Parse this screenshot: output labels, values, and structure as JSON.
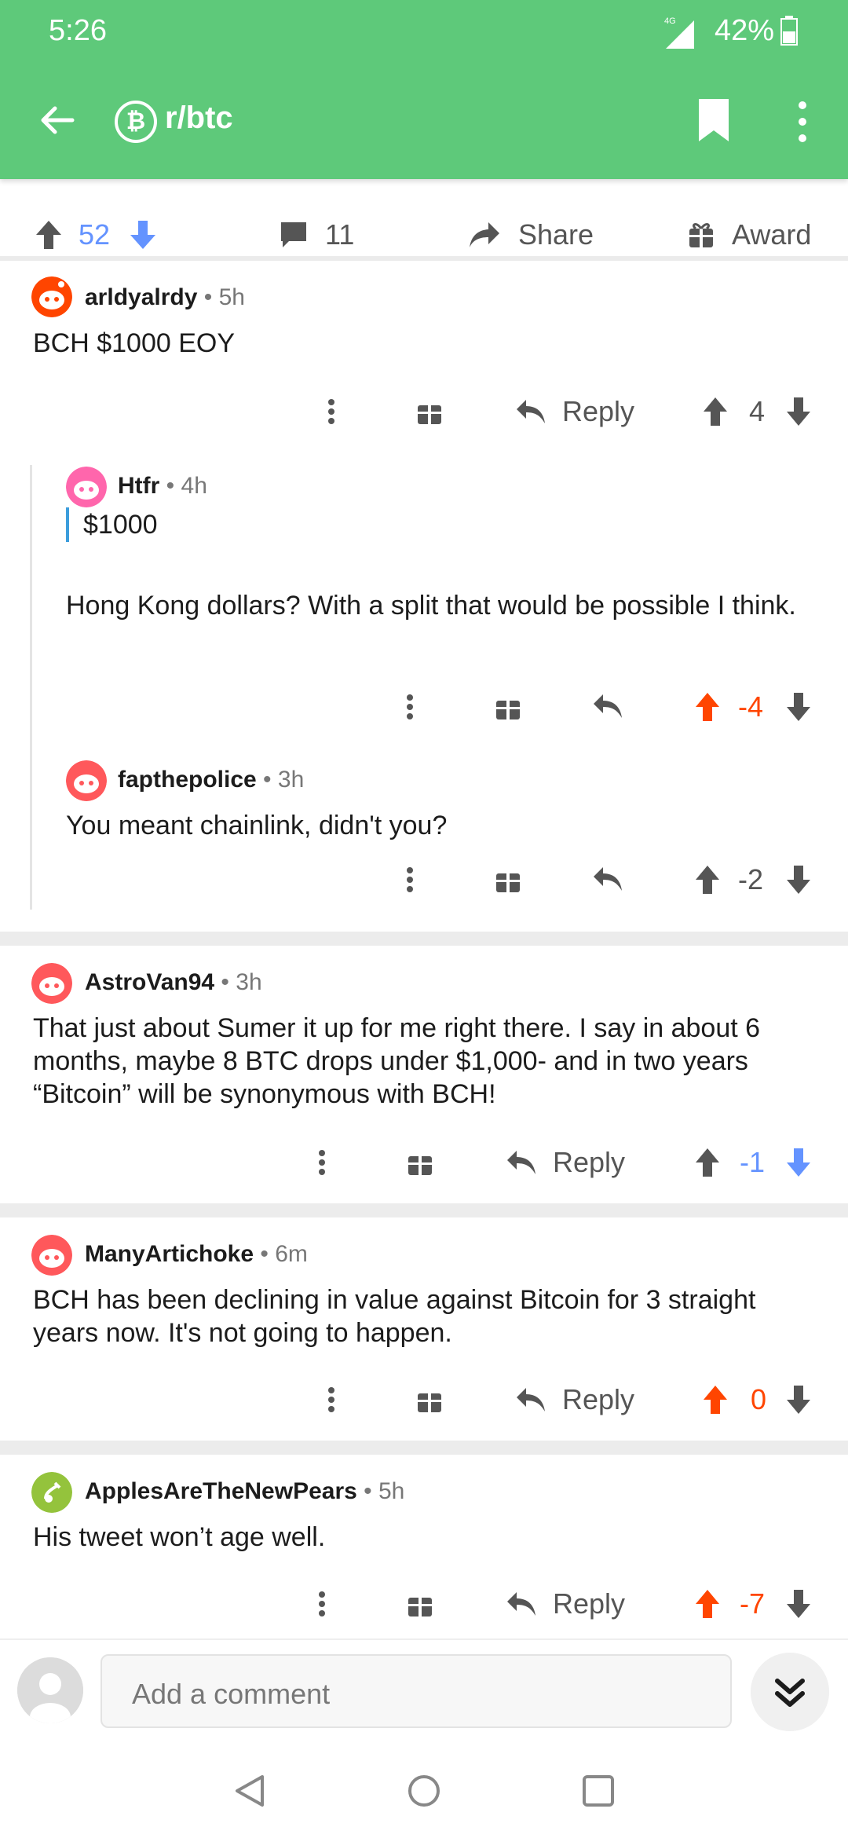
{
  "status_bar": {
    "time": "5:26",
    "network": "4G",
    "battery": "42%"
  },
  "app_bar": {
    "subreddit": "r/btc",
    "subreddit_icon": "bitcoin-icon"
  },
  "post_actions": {
    "score": "52",
    "comments": "11",
    "share_label": "Share",
    "award_label": "Award"
  },
  "comments": [
    {
      "user": "arldyalrdy",
      "age": "5h",
      "text": "BCH $1000 EOY",
      "score": "4",
      "reply_label": "Reply"
    },
    {
      "user": "Htfr",
      "age": "4h",
      "quote": "$1000",
      "text": "Hong Kong dollars? With a split that would be possible I think.",
      "score": "-4"
    },
    {
      "user": "fapthepolice",
      "age": "3h",
      "text": "You meant chainlink, didn't you?",
      "score": "-2"
    },
    {
      "user": "AstroVan94",
      "age": "3h",
      "text": "That just about Sumer it up for me right there. I say in about 6 months, maybe 8 BTC drops under $1,000- and in two years “Bitcoin” will be synonymous with BCH!",
      "score": "-1",
      "reply_label": "Reply"
    },
    {
      "user": "ManyArtichoke",
      "age": "6m",
      "text": "BCH has been declining in value against Bitcoin for 3 straight years now. It's not going to happen.",
      "score": "0",
      "reply_label": "Reply"
    },
    {
      "user": "ApplesAreTheNewPears",
      "age": "5h",
      "text": "His tweet won’t age well.",
      "score": "-7",
      "reply_label": "Reply"
    }
  ],
  "composer": {
    "placeholder": "Add a comment"
  },
  "colors": {
    "header": "#5ec97a",
    "upvote": "#ff4500",
    "downvote": "#6493ff",
    "thread_quote": "#3c9ddc"
  }
}
